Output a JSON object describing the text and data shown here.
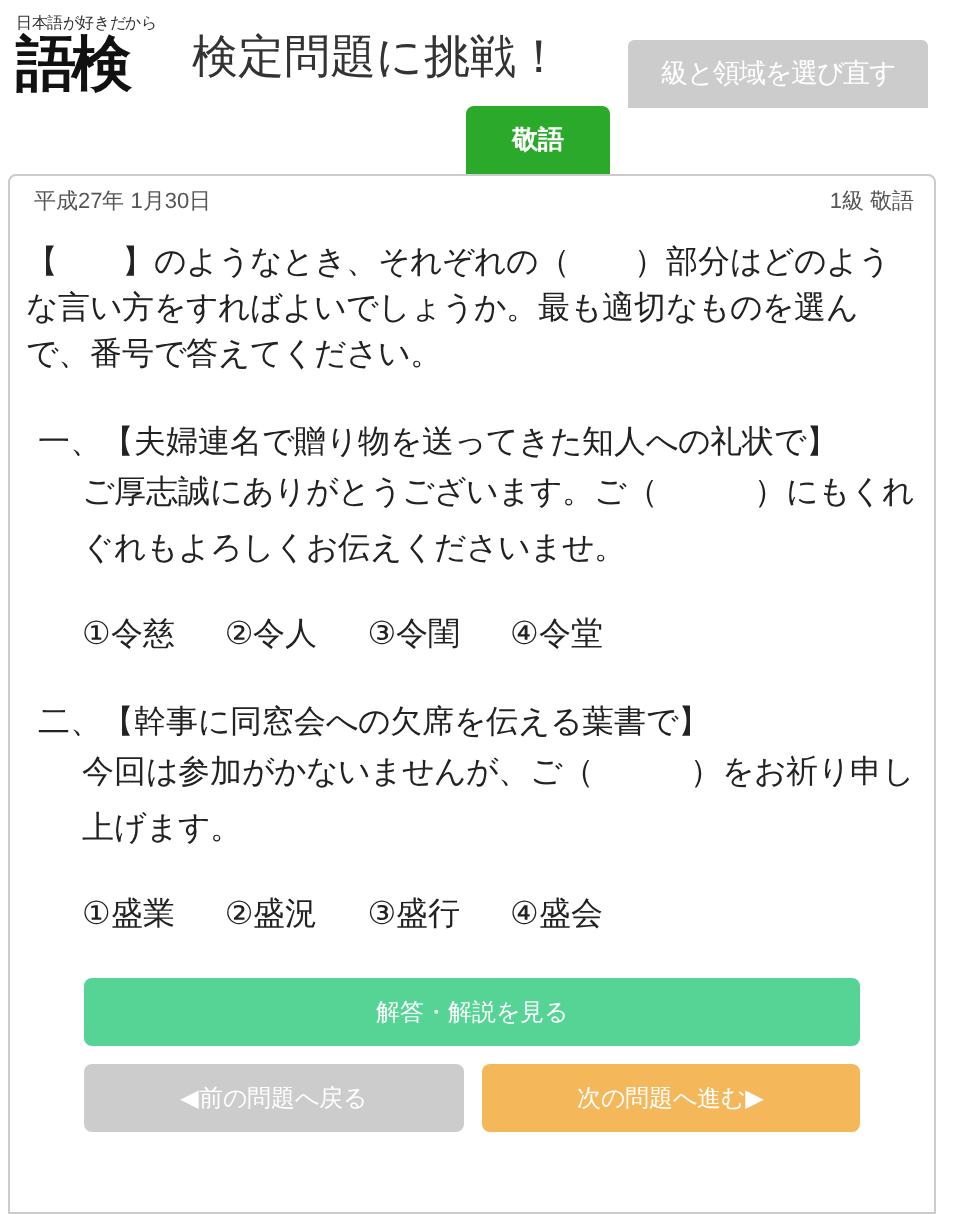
{
  "header": {
    "logo": {
      "tagline": "日本語が好きだから",
      "mark": "語検"
    },
    "title": "検定問題に挑戦！",
    "reselect_button": "級と領域を選び直す"
  },
  "tabs": [
    {
      "label": "敬語",
      "selected": true
    }
  ],
  "card": {
    "date": "平成27年 1月30日",
    "level": "1級 敬語",
    "instruction": "【　　】のようなとき、それぞれの（　　）部分はどのような言い方をすればよいでしょうか。最も適切なものを選んで、番号で答えてください。",
    "questions": [
      {
        "heading": "一、【夫婦連名で贈り物を送ってきた知人への礼状で】",
        "sentence": "ご厚志誠にありがとうございます。ご（　　　）にもくれぐれもよろしくお伝えくださいませ。",
        "choices": [
          "①令慈",
          "②令人",
          "③令閨",
          "④令堂"
        ]
      },
      {
        "heading": "二、【幹事に同窓会への欠席を伝える葉書で】",
        "sentence": "今回は参加がかないませんが、ご（　　　）をお祈り申し上げます。",
        "choices": [
          "①盛業",
          "②盛況",
          "③盛行",
          "④盛会"
        ]
      }
    ],
    "answer_button": "解答・解説を見る",
    "prev_button": "◀前の問題へ戻る",
    "next_button": "次の問題へ進む▶"
  }
}
